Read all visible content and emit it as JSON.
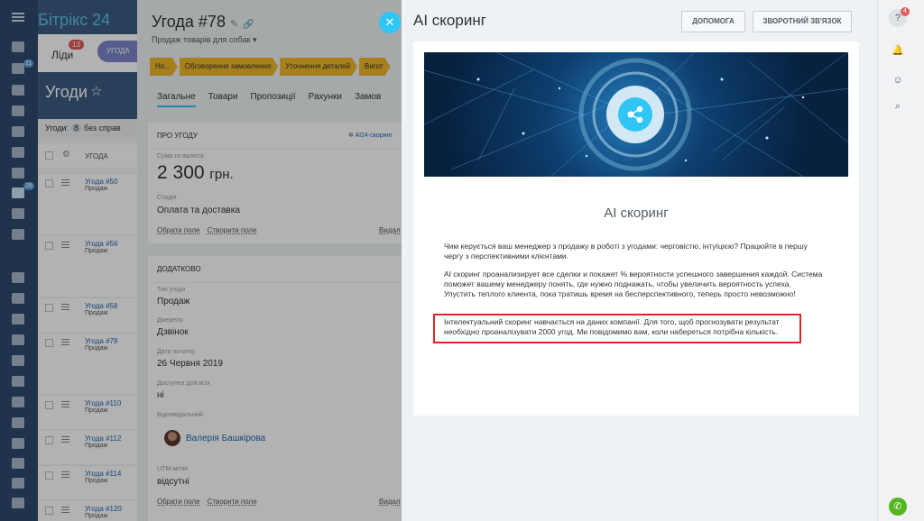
{
  "app": {
    "logo_main": "Бітрікс",
    "logo_num": "24"
  },
  "leftnav": {
    "badge_1": "11",
    "badge_2": "28"
  },
  "crm": {
    "tab_leads": "Ліди",
    "tab_leads_badge": "13",
    "tab_deals": "УГОДА",
    "title": "Угоди",
    "filter_label": "Угоди:",
    "filter_count": "8",
    "filter_text": "без справ",
    "column_header": "УГОДА",
    "rows": [
      {
        "name": "Угода #50",
        "type": "Продаж"
      },
      {
        "name": "Угода #56",
        "type": "Продаж"
      },
      {
        "name": "Угода #58",
        "type": "Продаж"
      },
      {
        "name": "Угода #78",
        "type": "Продаж"
      },
      {
        "name": "Угода #110",
        "type": "Продаж"
      },
      {
        "name": "Угода #112",
        "type": "Продаж"
      },
      {
        "name": "Угода #114",
        "type": "Продаж"
      },
      {
        "name": "Угода #120",
        "type": "Продаж"
      }
    ]
  },
  "deal": {
    "title": "Угода #78",
    "subtitle": "Продаж товарів для собак",
    "stages": [
      "Но...",
      "Обговорення замовлення",
      "Уточнення деталей",
      "Вигот"
    ],
    "tabs": [
      "Загальне",
      "Товари",
      "Пропозиції",
      "Рахунки",
      "Замов"
    ],
    "about": {
      "header": "ПРО УГОДУ",
      "ai24": "AI24-скоринг",
      "sum_label": "Сума та валюта",
      "sum_value": "2 300",
      "sum_currency": "грн.",
      "stage_label": "Стадія",
      "stage_value": "Оплата та доставка",
      "link_pick": "Обрати поле",
      "link_create": "Створити поле",
      "link_delete": "Видал"
    },
    "extra": {
      "header": "ДОДАТКОВО",
      "type_label": "Тип угоди",
      "type_value": "Продаж",
      "source_label": "Джерело",
      "source_value": "Дзвінок",
      "date_label": "Дата початку",
      "date_value": "26 Червня 2019",
      "public_label": "Доступна для всіх",
      "public_value": "ні",
      "owner_label": "Відповідальний",
      "owner_value": "Валерія Башкірова",
      "utm_label": "UTM-мітки",
      "utm_value": "відсутні",
      "link_pick": "Обрати поле",
      "link_create": "Створити поле",
      "link_delete": "Видал"
    }
  },
  "ai": {
    "title": "AI скоринг",
    "btn_help": "ДОПОМОГА",
    "btn_feedback": "ЗВОРОТНИЙ ЗВ'ЯЗОК",
    "heading": "AI скоринг",
    "p1": "Чим керується ваш менеджер з продажу в роботі з угодами: черговістю, інтуїцією? Працюйте в першу чергу з перспективними клієнтами.",
    "p2": "AI скоринг проанализирует все сделки и покажет % вероятности успешного завершения каждой. Система поможет вашему менеджеру понять, где нужно поднажать, чтобы увеличить вероятность успеха. Упустить теплого клиента, пока тратишь время на бесперспективного, теперь просто невозможно!",
    "p3": "Інтелектуальний скоринг навчається на даних компанії. Для того, щоб прогнозувати результат необхідно проаналізувати 2000 угод. Ми повідомимо вам, коли набереться потрібна кількість."
  },
  "rightbar": {
    "help_badge": "4"
  }
}
